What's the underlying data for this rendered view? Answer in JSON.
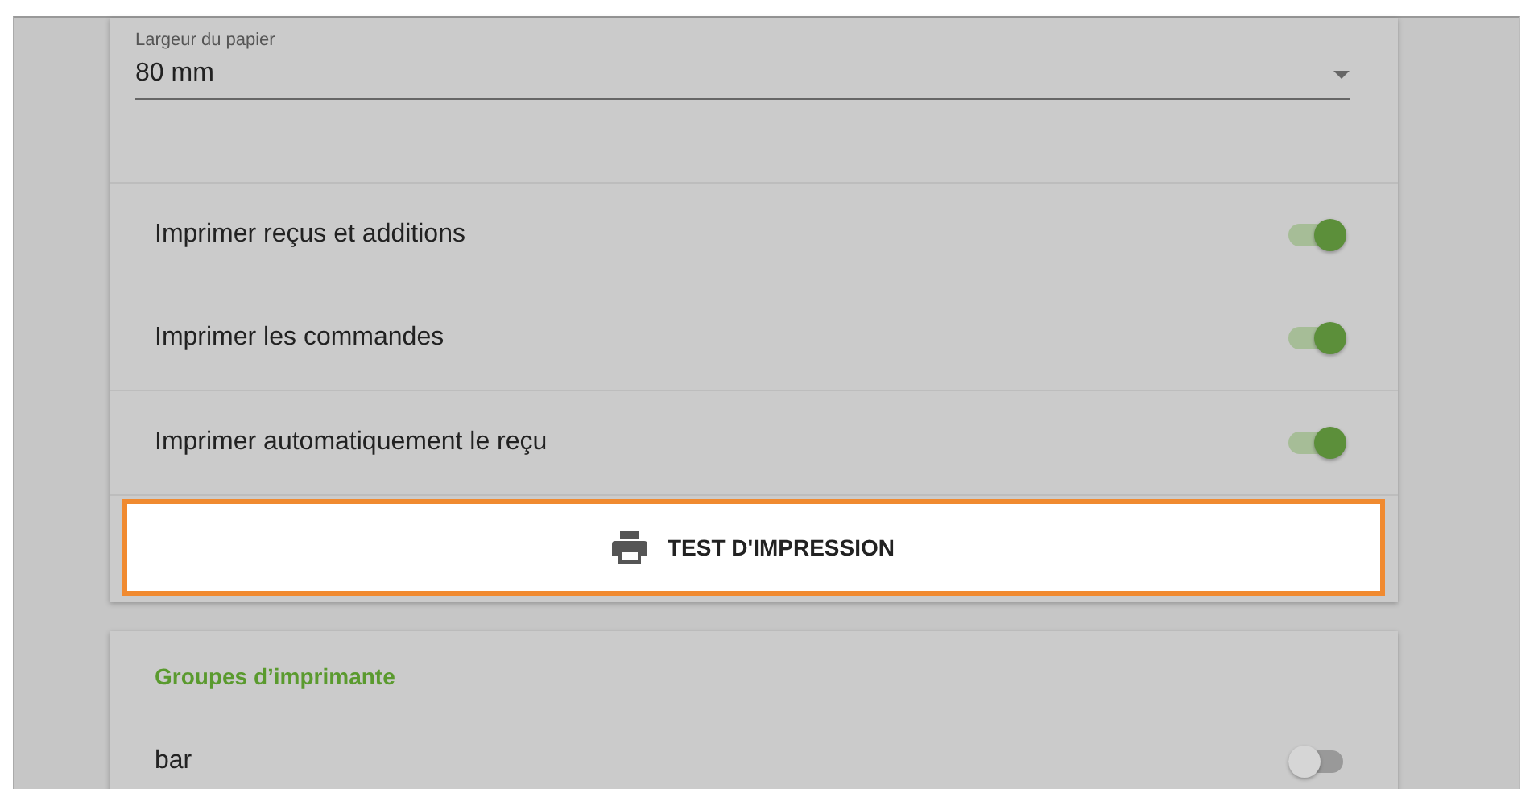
{
  "paper_width": {
    "label": "Largeur du papier",
    "value": "80 mm"
  },
  "toggles": [
    {
      "label": "Imprimer reçus et additions",
      "on": true,
      "divider_before": true
    },
    {
      "label": "Imprimer les commandes",
      "on": true,
      "divider_before": false
    },
    {
      "label": "Imprimer automatiquement le reçu",
      "on": true,
      "divider_before": true
    }
  ],
  "test_button": {
    "label": "TEST D'IMPRESSION"
  },
  "printer_groups": {
    "title": "Groupes d’imprimante",
    "items": [
      {
        "label": "bar",
        "on": false
      }
    ]
  }
}
